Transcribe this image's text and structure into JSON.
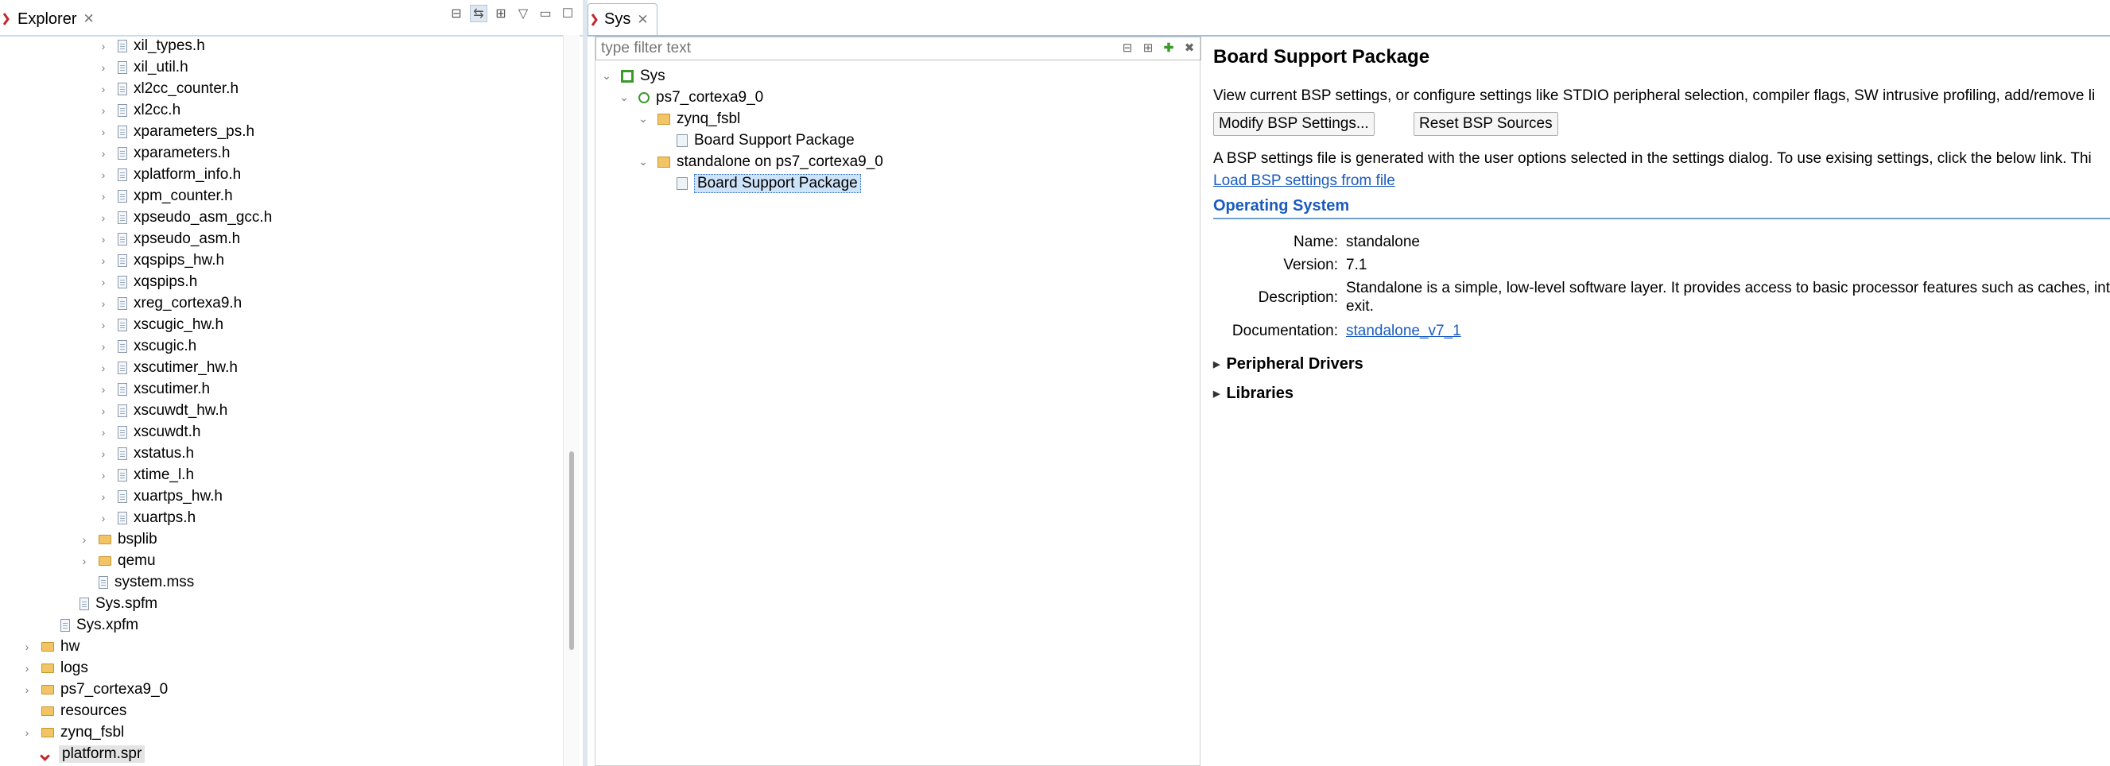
{
  "explorer": {
    "tab_title": "Explorer",
    "tree": [
      {
        "label": "xil_types.h",
        "type": "file",
        "depth": 4
      },
      {
        "label": "xil_util.h",
        "type": "file",
        "depth": 4
      },
      {
        "label": "xl2cc_counter.h",
        "type": "file",
        "depth": 4
      },
      {
        "label": "xl2cc.h",
        "type": "file",
        "depth": 4
      },
      {
        "label": "xparameters_ps.h",
        "type": "file",
        "depth": 4
      },
      {
        "label": "xparameters.h",
        "type": "file",
        "depth": 4
      },
      {
        "label": "xplatform_info.h",
        "type": "file",
        "depth": 4
      },
      {
        "label": "xpm_counter.h",
        "type": "file",
        "depth": 4
      },
      {
        "label": "xpseudo_asm_gcc.h",
        "type": "file",
        "depth": 4
      },
      {
        "label": "xpseudo_asm.h",
        "type": "file",
        "depth": 4
      },
      {
        "label": "xqspips_hw.h",
        "type": "file",
        "depth": 4
      },
      {
        "label": "xqspips.h",
        "type": "file",
        "depth": 4
      },
      {
        "label": "xreg_cortexa9.h",
        "type": "file",
        "depth": 4
      },
      {
        "label": "xscugic_hw.h",
        "type": "file",
        "depth": 4
      },
      {
        "label": "xscugic.h",
        "type": "file",
        "depth": 4
      },
      {
        "label": "xscutimer_hw.h",
        "type": "file",
        "depth": 4
      },
      {
        "label": "xscutimer.h",
        "type": "file",
        "depth": 4
      },
      {
        "label": "xscuwdt_hw.h",
        "type": "file",
        "depth": 4
      },
      {
        "label": "xscuwdt.h",
        "type": "file",
        "depth": 4
      },
      {
        "label": "xstatus.h",
        "type": "file",
        "depth": 4
      },
      {
        "label": "xtime_l.h",
        "type": "file",
        "depth": 4
      },
      {
        "label": "xuartps_hw.h",
        "type": "file",
        "depth": 4
      },
      {
        "label": "xuartps.h",
        "type": "file",
        "depth": 4
      },
      {
        "label": "bsplib",
        "type": "folder",
        "depth": 3
      },
      {
        "label": "qemu",
        "type": "folder",
        "depth": 3
      },
      {
        "label": "system.mss",
        "type": "file-noarrow",
        "depth": 3
      },
      {
        "label": "Sys.spfm",
        "type": "file-noarrow",
        "depth": 2
      },
      {
        "label": "Sys.xpfm",
        "type": "file-noarrow",
        "depth": 1
      },
      {
        "label": "hw",
        "type": "folder",
        "depth": 0
      },
      {
        "label": "logs",
        "type": "folder",
        "depth": 0
      },
      {
        "label": "ps7_cortexa9_0",
        "type": "folder",
        "depth": 0
      },
      {
        "label": "resources",
        "type": "folder-noarrow",
        "depth": 0
      },
      {
        "label": "zynq_fsbl",
        "type": "folder",
        "depth": 0
      },
      {
        "label": "platform.spr",
        "type": "spr",
        "depth": 0,
        "selected": true
      }
    ]
  },
  "editor": {
    "tab_title": "Sys",
    "filter_placeholder": "type filter text",
    "tree": {
      "root": "Sys",
      "cpu": "ps7_cortexa9_0",
      "fsbl": "zynq_fsbl",
      "fsbl_bsp": "Board Support Package",
      "standalone": "standalone on ps7_cortexa9_0",
      "standalone_bsp": "Board Support Package"
    },
    "details": {
      "title": "Board Support Package",
      "intro": "View current BSP settings, or configure settings like STDIO peripheral selection, compiler flags, SW intrusive profiling, add/remove li",
      "modify_button": "Modify BSP Settings...",
      "reset_button": "Reset BSP Sources",
      "bsp_note": "A BSP settings file is generated with the user options selected in the settings dialog. To use exising settings, click the below link. Thi",
      "load_link": "Load BSP settings from file",
      "os_heading": "Operating System",
      "name_key": "Name:",
      "name_val": "standalone",
      "version_key": "Version:",
      "version_val": "7.1",
      "description_key": "Description:",
      "description_val_line1": "Standalone is a simple, low-level software layer. It provides access to basic processor features such as caches, inter",
      "description_val_line2": "exit.",
      "documentation_key": "Documentation:",
      "documentation_link": "standalone_v7_1",
      "peripheral_drivers": "Peripheral Drivers",
      "libraries": "Libraries"
    }
  }
}
